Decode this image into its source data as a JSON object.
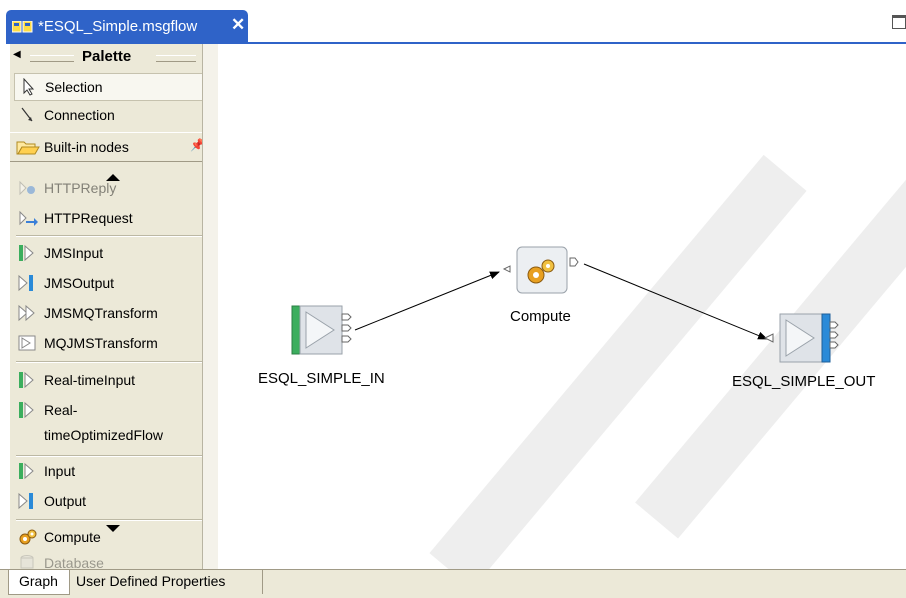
{
  "editor": {
    "tab_title": "*ESQL_Simple.msgflow",
    "close_glyph": "✕"
  },
  "palette": {
    "title": "Palette",
    "tools": [
      "Selection",
      "Connection"
    ],
    "drawer_label": "Built-in nodes",
    "nodes": [
      "HTTPReply",
      "HTTPRequest",
      "JMSInput",
      "JMSOutput",
      "JMSMQTransform",
      "MQJMSTransform",
      "Real-timeInput",
      "Real-",
      "timeOptimizedFlow",
      "Input",
      "Output",
      "Compute",
      "Database"
    ]
  },
  "flow": {
    "nodes": [
      {
        "name": "ESQL_SIMPLE_IN",
        "type": "MQInput"
      },
      {
        "name": "Compute",
        "type": "Compute"
      },
      {
        "name": "ESQL_SIMPLE_OUT",
        "type": "MQOutput"
      }
    ],
    "connections": [
      {
        "from": "ESQL_SIMPLE_IN",
        "to": "Compute"
      },
      {
        "from": "Compute",
        "to": "ESQL_SIMPLE_OUT"
      }
    ]
  },
  "bottom_tabs": [
    "Graph",
    "User Defined Properties"
  ],
  "colors": {
    "tab_active": "#2f63c8",
    "palette_bg": "#ece9d8",
    "input_node": "#3cae5e",
    "output_node": "#2a8ad8",
    "watermark": "#eeeeee"
  }
}
